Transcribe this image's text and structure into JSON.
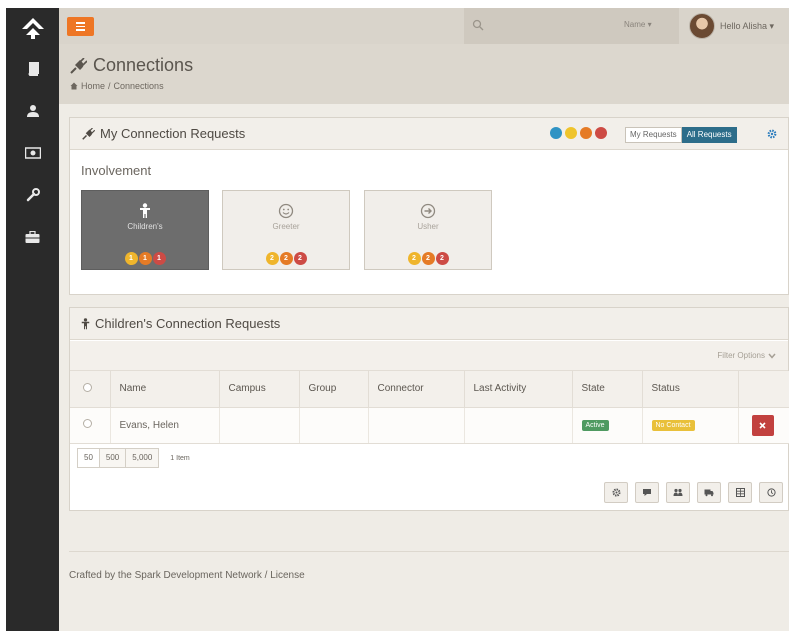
{
  "topbar": {
    "search_placeholder": "",
    "name_dropdown": "Name ▾",
    "greeting": "Hello Alisha ▾"
  },
  "sidebar": {
    "items": [
      {
        "icon": "book-icon"
      },
      {
        "icon": "user-icon"
      },
      {
        "icon": "money-icon"
      },
      {
        "icon": "wrench-icon"
      },
      {
        "icon": "briefcase-icon"
      }
    ]
  },
  "page": {
    "title": "Connections",
    "breadcrumb_home": "Home",
    "breadcrumb_sep": "/",
    "breadcrumb_current": "Connections"
  },
  "requests_panel": {
    "title": "My Connection Requests",
    "toggle_my": "My Requests",
    "toggle_all": "All Requests",
    "dot_colors": [
      "#2f93c4",
      "#efc42c",
      "#e57b26",
      "#cd4b45"
    ],
    "involvement_label": "Involvement",
    "cards": [
      {
        "label": "Children's",
        "active": true,
        "badges": [
          "1",
          "1",
          "1"
        ]
      },
      {
        "label": "Greeter",
        "active": false,
        "badges": [
          "2",
          "2",
          "2"
        ]
      },
      {
        "label": "Usher",
        "active": false,
        "badges": [
          "2",
          "2",
          "2"
        ]
      }
    ],
    "badge_colors": [
      "#efb52c",
      "#e57b26",
      "#cd4b45"
    ]
  },
  "children_panel": {
    "title": "Children's Connection Requests",
    "filter_options": "Filter Options",
    "columns": [
      "Name",
      "Campus",
      "Group",
      "Connector",
      "Last Activity",
      "State",
      "Status"
    ],
    "rows": [
      {
        "name": "Evans, Helen",
        "campus": "",
        "group": "",
        "connector": "",
        "last_activity": "",
        "state": "Active",
        "status": "No Contact"
      }
    ],
    "page_sizes": [
      "50",
      "500",
      "5,000"
    ],
    "item_count": "1 Item"
  },
  "footer": {
    "text": "Crafted by the Spark Development Network / License"
  },
  "colors": {
    "accent": "#ee7625",
    "sidebar": "#2a2a2a",
    "primary": "#2d6d8a",
    "danger": "#c2413f"
  }
}
